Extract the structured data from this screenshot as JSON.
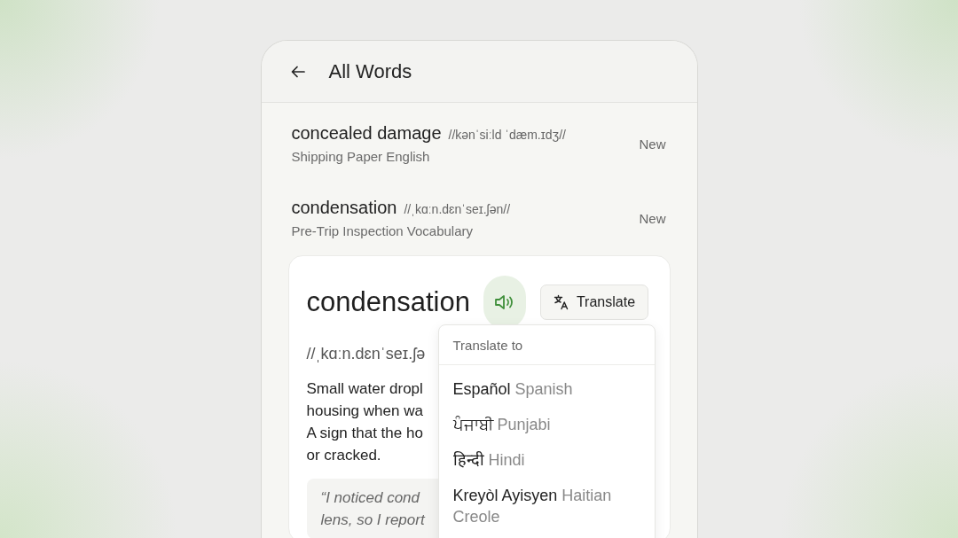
{
  "header": {
    "title": "All Words"
  },
  "words": [
    {
      "term": "concealed damage",
      "phonetic": "//kənˈsiːld ˈdæm.ɪdʒ//",
      "deck": "Shipping Paper English",
      "status": "New"
    },
    {
      "term": "condensation",
      "phonetic": "//ˌkɑːn.dɛnˈseɪ.ʃən//",
      "deck": "Pre-Trip Inspection Vocabulary",
      "status": "New"
    }
  ],
  "detail": {
    "term": "condensation",
    "translate_button": "Translate",
    "phonetic": "//ˌkɑːn.dɛnˈseɪ.ʃə",
    "definition_lines": [
      "Small water dropl",
      "housing when wa",
      "A sign that the ho",
      "or cracked."
    ],
    "example_lines": [
      "“I noticed cond",
      "lens, so I report"
    ]
  },
  "translate_menu": {
    "heading": "Translate to",
    "languages": [
      {
        "native": "Español",
        "english": "Spanish"
      },
      {
        "native": "ਪੰਜਾਬੀ",
        "english": "Punjabi"
      },
      {
        "native": "हिन्दी",
        "english": "Hindi"
      },
      {
        "native": "Kreyòl Ayisyen",
        "english": "Haitian Creole"
      }
    ]
  }
}
